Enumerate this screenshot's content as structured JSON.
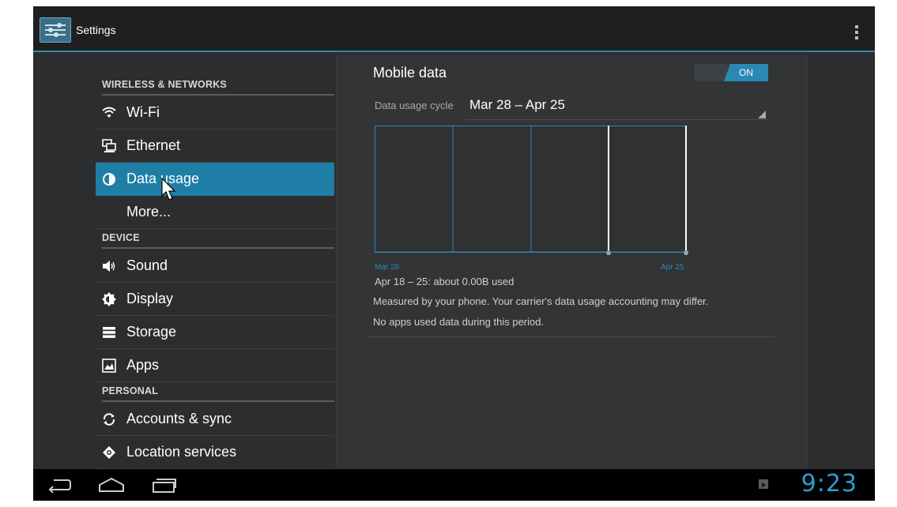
{
  "app": {
    "title": "Settings"
  },
  "nav": {
    "headers": {
      "wireless": "WIRELESS & NETWORKS",
      "device": "DEVICE",
      "personal": "PERSONAL"
    },
    "items": [
      {
        "label": "Wi-Fi",
        "icon": "wifi-icon"
      },
      {
        "label": "Ethernet",
        "icon": "ethernet-icon"
      },
      {
        "label": "Data usage",
        "icon": "data-usage-icon",
        "selected": true
      },
      {
        "label": "More...",
        "icon": ""
      },
      {
        "label": "Sound",
        "icon": "speaker-icon"
      },
      {
        "label": "Display",
        "icon": "brightness-icon"
      },
      {
        "label": "Storage",
        "icon": "storage-icon"
      },
      {
        "label": "Apps",
        "icon": "apps-icon"
      },
      {
        "label": "Accounts & sync",
        "icon": "sync-icon"
      },
      {
        "label": "Location services",
        "icon": "location-icon"
      }
    ]
  },
  "detail": {
    "mobile_data_label": "Mobile data",
    "toggle_state": "ON",
    "cycle_label": "Data usage cycle",
    "cycle_value": "Mar 28 – Apr 25",
    "usage_text": "Apr 18 – 25: about 0.00B used",
    "measured_text": "Measured by your phone. Your carrier's data usage accounting may differ.",
    "no_apps_text": "No apps used data during this period."
  },
  "chart_data": {
    "type": "line",
    "x_start_label": "Mar 28",
    "x_end_label": "Apr 25",
    "series": [
      {
        "values": [
          0,
          0,
          0,
          0,
          0
        ]
      }
    ],
    "grid": true
  },
  "system": {
    "clock": "9:23"
  },
  "colors": {
    "accent": "#2b88b4",
    "selected_bg": "#1f7ea6",
    "panel_bg": "#2b2d2e",
    "detail_bg": "#323436",
    "clock": "#2b9fd1"
  }
}
